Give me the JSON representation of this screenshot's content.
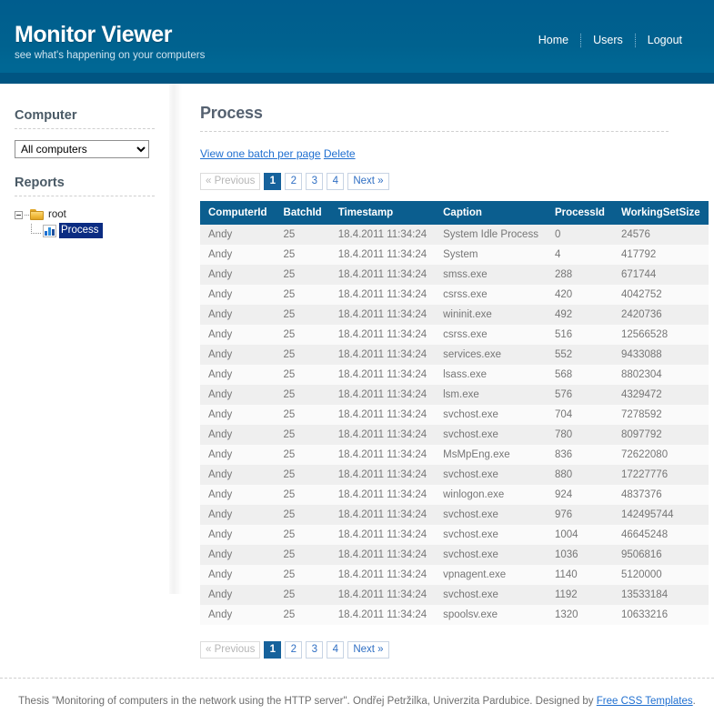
{
  "header": {
    "logo_title": "Monitor Viewer",
    "logo_tagline": "see what's happening on your computers",
    "nav": [
      {
        "label": "Home"
      },
      {
        "label": "Users"
      },
      {
        "label": "Logout"
      }
    ]
  },
  "sidebar": {
    "computer_heading": "Computer",
    "computer_select": {
      "value": "All computers",
      "options": [
        "All computers"
      ]
    },
    "reports_heading": "Reports",
    "tree": {
      "root_label": "root",
      "child_label": "Process",
      "root_icon": "folder-icon",
      "child_icon": "chart-icon",
      "child_selected": true
    }
  },
  "main": {
    "page_title": "Process",
    "links": {
      "view_one_batch": "View one batch per page",
      "delete": "Delete"
    },
    "pager": {
      "previous": "« Previous",
      "next": "Next »",
      "pages": [
        "1",
        "2",
        "3",
        "4"
      ],
      "current_page": "1"
    },
    "table": {
      "columns": [
        "ComputerId",
        "BatchId",
        "Timestamp",
        "Caption",
        "ProcessId",
        "WorkingSetSize"
      ],
      "rows": [
        [
          "Andy",
          "25",
          "18.4.2011 11:34:24",
          "System Idle Process",
          "0",
          "24576"
        ],
        [
          "Andy",
          "25",
          "18.4.2011 11:34:24",
          "System",
          "4",
          "417792"
        ],
        [
          "Andy",
          "25",
          "18.4.2011 11:34:24",
          "smss.exe",
          "288",
          "671744"
        ],
        [
          "Andy",
          "25",
          "18.4.2011 11:34:24",
          "csrss.exe",
          "420",
          "4042752"
        ],
        [
          "Andy",
          "25",
          "18.4.2011 11:34:24",
          "wininit.exe",
          "492",
          "2420736"
        ],
        [
          "Andy",
          "25",
          "18.4.2011 11:34:24",
          "csrss.exe",
          "516",
          "12566528"
        ],
        [
          "Andy",
          "25",
          "18.4.2011 11:34:24",
          "services.exe",
          "552",
          "9433088"
        ],
        [
          "Andy",
          "25",
          "18.4.2011 11:34:24",
          "lsass.exe",
          "568",
          "8802304"
        ],
        [
          "Andy",
          "25",
          "18.4.2011 11:34:24",
          "lsm.exe",
          "576",
          "4329472"
        ],
        [
          "Andy",
          "25",
          "18.4.2011 11:34:24",
          "svchost.exe",
          "704",
          "7278592"
        ],
        [
          "Andy",
          "25",
          "18.4.2011 11:34:24",
          "svchost.exe",
          "780",
          "8097792"
        ],
        [
          "Andy",
          "25",
          "18.4.2011 11:34:24",
          "MsMpEng.exe",
          "836",
          "72622080"
        ],
        [
          "Andy",
          "25",
          "18.4.2011 11:34:24",
          "svchost.exe",
          "880",
          "17227776"
        ],
        [
          "Andy",
          "25",
          "18.4.2011 11:34:24",
          "winlogon.exe",
          "924",
          "4837376"
        ],
        [
          "Andy",
          "25",
          "18.4.2011 11:34:24",
          "svchost.exe",
          "976",
          "142495744"
        ],
        [
          "Andy",
          "25",
          "18.4.2011 11:34:24",
          "svchost.exe",
          "1004",
          "46645248"
        ],
        [
          "Andy",
          "25",
          "18.4.2011 11:34:24",
          "svchost.exe",
          "1036",
          "9506816"
        ],
        [
          "Andy",
          "25",
          "18.4.2011 11:34:24",
          "vpnagent.exe",
          "1140",
          "5120000"
        ],
        [
          "Andy",
          "25",
          "18.4.2011 11:34:24",
          "svchost.exe",
          "1192",
          "13533184"
        ],
        [
          "Andy",
          "25",
          "18.4.2011 11:34:24",
          "spoolsv.exe",
          "1320",
          "10633216"
        ]
      ]
    }
  },
  "footer": {
    "text_before": "Thesis \"Monitoring of computers in the network using the HTTP server\". Ondřej Petržilka, Univerzita Pardubice. Designed by ",
    "link": "Free CSS Templates",
    "text_after": "."
  },
  "colors": {
    "header_blue": "#006794",
    "header_band": "#005582",
    "table_header": "#0b5e8f",
    "accent_link": "#1f6fd0",
    "pager_current": "#16629c",
    "tree_selected": "#0b2c82"
  }
}
